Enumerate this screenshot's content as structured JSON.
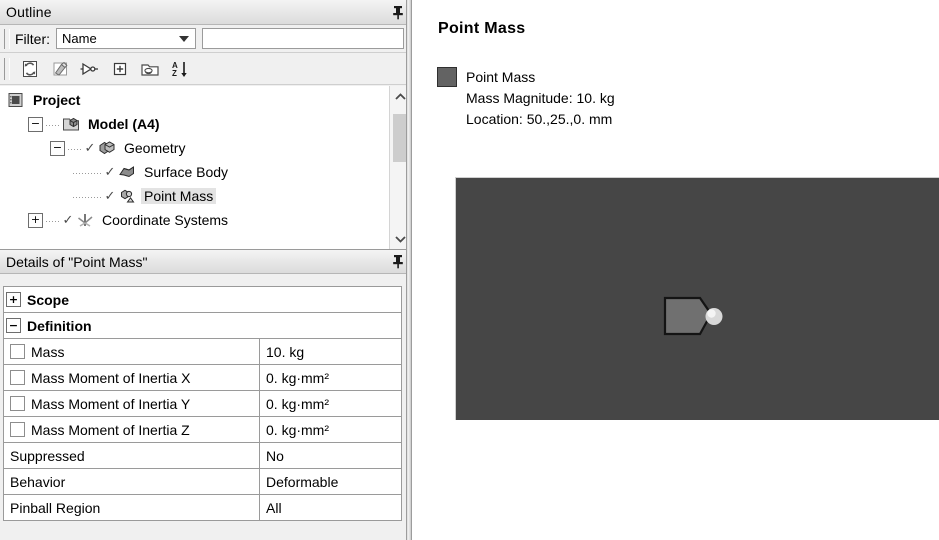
{
  "outline": {
    "title": "Outline",
    "pin_icon": "pushpin-icon",
    "filter": {
      "label": "Filter:",
      "select_value": "Name",
      "input_value": "",
      "input_placeholder": ""
    },
    "toolbar": [
      {
        "name": "refresh-icon",
        "title": "Refresh"
      },
      {
        "name": "eraser-icon",
        "title": "Clear Generated Data"
      },
      {
        "name": "probe-icon",
        "title": "Show Errors"
      },
      {
        "name": "expand-all-icon",
        "title": "Expand All"
      },
      {
        "name": "collapse-folder-icon",
        "title": "Collapse All"
      },
      {
        "name": "sort-az-icon",
        "title": "Sort"
      }
    ],
    "tree": [
      {
        "label": "Project",
        "icon": "project-icon",
        "indent": 0,
        "bold": true,
        "expander": "",
        "check": false,
        "selected": false
      },
      {
        "label": "Model (A4)",
        "icon": "model-icon",
        "indent": 1,
        "bold": true,
        "expander": "-",
        "check": false,
        "selected": false
      },
      {
        "label": "Geometry",
        "icon": "geometry-icon",
        "indent": 2,
        "bold": false,
        "expander": "-",
        "check": true,
        "selected": false
      },
      {
        "label": "Surface Body",
        "icon": "surface-body-icon",
        "indent": 3,
        "bold": false,
        "expander": "",
        "check": true,
        "selected": false
      },
      {
        "label": "Point Mass",
        "icon": "point-mass-icon",
        "indent": 3,
        "bold": false,
        "expander": "",
        "check": true,
        "selected": true
      },
      {
        "label": "Coordinate Systems",
        "icon": "coordinate-systems-icon",
        "indent": 1,
        "bold": false,
        "expander": "+",
        "check": true,
        "selected": false
      }
    ]
  },
  "details": {
    "title": "Details of \"Point Mass\"",
    "pin_icon": "pushpin-icon",
    "rows": [
      {
        "type": "category",
        "expander": "+",
        "label": "Scope"
      },
      {
        "type": "category",
        "expander": "-",
        "label": "Definition"
      },
      {
        "type": "prop",
        "checkbox": true,
        "label": "Mass",
        "value": "10. kg"
      },
      {
        "type": "prop",
        "checkbox": true,
        "label": "Mass Moment of Inertia X",
        "value": "0. kg·mm²"
      },
      {
        "type": "prop",
        "checkbox": true,
        "label": "Mass Moment of Inertia Y",
        "value": "0. kg·mm²"
      },
      {
        "type": "prop",
        "checkbox": true,
        "label": "Mass Moment of Inertia Z",
        "value": "0. kg·mm²"
      },
      {
        "type": "prop",
        "checkbox": false,
        "label": "Suppressed",
        "value": "No"
      },
      {
        "type": "prop",
        "checkbox": false,
        "label": "Behavior",
        "value": "Deformable"
      },
      {
        "type": "prop",
        "checkbox": false,
        "label": "Pinball Region",
        "value": "All"
      }
    ]
  },
  "report": {
    "title": "Point Mass",
    "legend": {
      "swatch_color": "#636363",
      "name": "Point Mass",
      "mass_line": "Mass Magnitude: 10. kg",
      "location_line": "Location: 50.,25.,0. mm"
    },
    "viewport": {
      "background_color": "#464646",
      "body_color": "#707070",
      "marker_color": "#e8e8e8"
    }
  }
}
